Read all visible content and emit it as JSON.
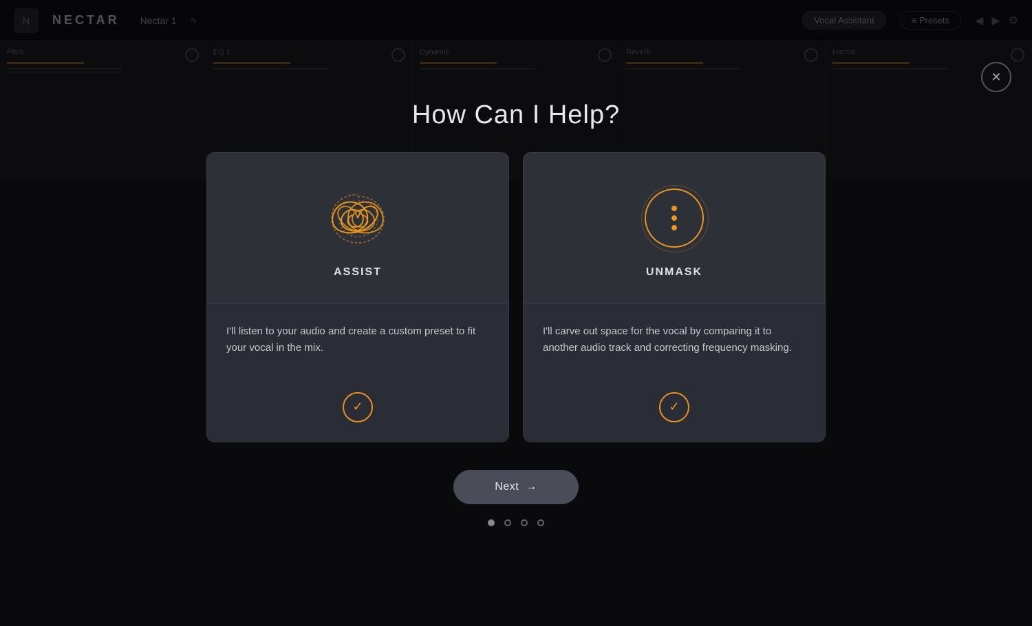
{
  "app": {
    "name": "NECTAR",
    "track_name": "Nectar 1",
    "edit_icon": "✎"
  },
  "header": {
    "vocal_assistant_label": "Vocal Assistant",
    "presets_label": "≡  Presets"
  },
  "modal": {
    "title": "How Can I Help?",
    "close_label": "✕"
  },
  "cards": [
    {
      "id": "assist",
      "label": "ASSIST",
      "description": "I'll listen to your audio and create a custom preset to fit your vocal in the mix.",
      "icon_type": "swirl"
    },
    {
      "id": "unmask",
      "label": "UNMASK",
      "description": "I'll carve out space for the vocal by comparing it to another audio track and correcting frequency masking.",
      "icon_type": "dots"
    }
  ],
  "next_button": {
    "label": "Next",
    "arrow": "→"
  },
  "pagination": {
    "total": 4,
    "active": 0
  },
  "colors": {
    "accent": "#e8961e",
    "bg_dark": "#1c1c22",
    "card_bg": "#2e3038",
    "card_bottom_bg": "#2a2d35",
    "text_primary": "#e8e8e8",
    "text_secondary": "#c8c8c8"
  }
}
